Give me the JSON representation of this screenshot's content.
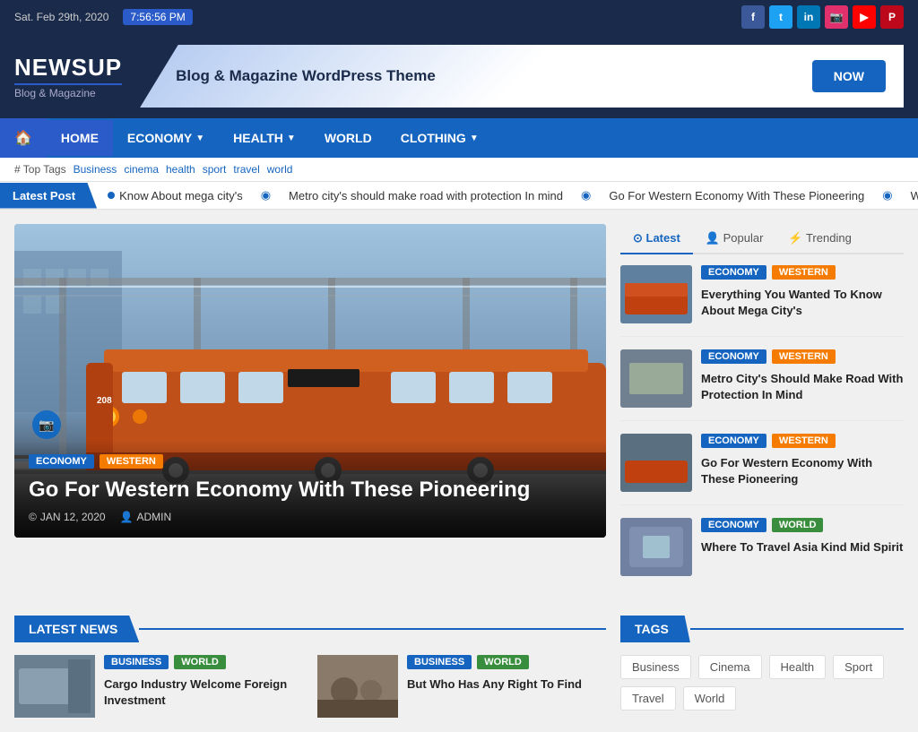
{
  "topbar": {
    "date": "Sat. Feb 29th, 2020",
    "time": "7:56:56 PM"
  },
  "logo": {
    "title": "NEWSUP",
    "subtitle": "Blog & Magazine"
  },
  "banner": {
    "text": "Blog & Magazine WordPress Theme",
    "button": "NOW"
  },
  "nav": {
    "items": [
      {
        "label": "HOME",
        "active": true,
        "hasDropdown": false
      },
      {
        "label": "ECONOMY",
        "active": false,
        "hasDropdown": true
      },
      {
        "label": "HEALTH",
        "active": false,
        "hasDropdown": true
      },
      {
        "label": "WORLD",
        "active": false,
        "hasDropdown": false
      },
      {
        "label": "CLOTHING",
        "active": false,
        "hasDropdown": true
      }
    ]
  },
  "tags": {
    "label": "# Top Tags",
    "items": [
      "Business",
      "cinema",
      "health",
      "sport",
      "travel",
      "world"
    ]
  },
  "ticker": {
    "label": "Latest Post",
    "items": [
      "Know About mega city's",
      "Metro city's should make road with protection In mind",
      "Go For Western Economy With These Pioneering",
      "Wh..."
    ]
  },
  "featured": {
    "badges": [
      "ECONOMY",
      "WESTERN"
    ],
    "title": "Go For Western Economy With These Pioneering",
    "date": "JAN 12, 2020",
    "author": "ADMIN"
  },
  "tabs": {
    "items": [
      "Latest",
      "Popular",
      "Trending"
    ]
  },
  "sidebar_articles": [
    {
      "badges": [
        "ECONOMY",
        "WESTERN"
      ],
      "title": "Everything You Wanted To Know About Mega City's"
    },
    {
      "badges": [
        "ECONOMY",
        "WESTERN"
      ],
      "title": "Metro City's Should Make Road With Protection In Mind"
    },
    {
      "badges": [
        "ECONOMY",
        "WESTERN"
      ],
      "title": "Go For Western Economy With These Pioneering"
    },
    {
      "badges": [
        "ECONOMY",
        "WORLD"
      ],
      "title": "Where To Travel Asia Kind Mid Spirit"
    }
  ],
  "latest_news": {
    "title": "LATEST NEWS"
  },
  "news_items": [
    {
      "badges": [
        "BUSINESS",
        "WORLD"
      ],
      "title": "Cargo Industry Welcome Foreign Investment"
    },
    {
      "badges": [
        "BUSINESS",
        "WORLD"
      ],
      "title": "But Who Has Any Right To Find"
    }
  ],
  "tags_section": {
    "title": "TAGS",
    "items": [
      "Business",
      "Cinema",
      "Health",
      "Sport",
      "Travel",
      "World"
    ]
  },
  "social": {
    "icons": [
      {
        "name": "facebook",
        "label": "f",
        "class": "si-fb"
      },
      {
        "name": "twitter",
        "label": "t",
        "class": "si-tw"
      },
      {
        "name": "linkedin",
        "label": "in",
        "class": "si-li"
      },
      {
        "name": "instagram",
        "label": "ig",
        "class": "si-ig"
      },
      {
        "name": "youtube",
        "label": "▶",
        "class": "si-yt"
      },
      {
        "name": "pinterest",
        "label": "p",
        "class": "si-pt"
      }
    ]
  }
}
